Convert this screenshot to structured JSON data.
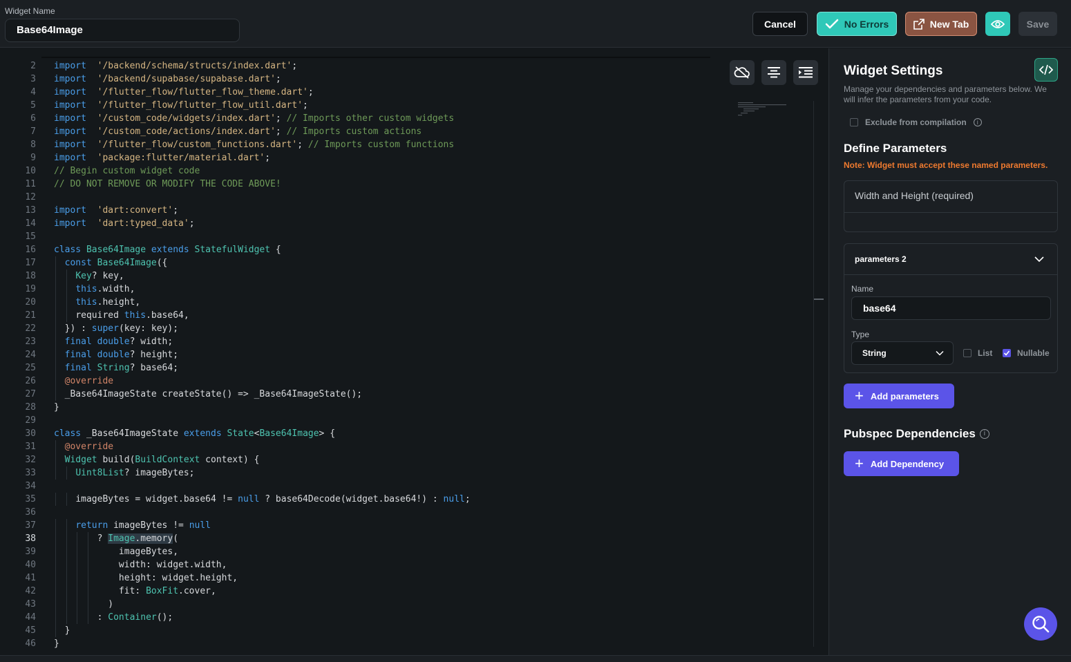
{
  "header": {
    "widget_name_label": "Widget Name",
    "widget_name_value": "Base64Image",
    "cancel_label": "Cancel",
    "no_errors_label": "No Errors",
    "new_tab_label": "New Tab",
    "save_label": "Save"
  },
  "editor": {
    "active_line": 38,
    "lines": [
      {
        "n": 2,
        "indent": 0,
        "tokens": [
          [
            "kw",
            "import"
          ],
          [
            "",
            "  "
          ],
          [
            "str",
            "'/backend/schema/structs/index.dart'"
          ],
          [
            "",
            ";"
          ]
        ]
      },
      {
        "n": 3,
        "indent": 0,
        "tokens": [
          [
            "kw",
            "import"
          ],
          [
            "",
            "  "
          ],
          [
            "str",
            "'/backend/supabase/supabase.dart'"
          ],
          [
            "",
            ";"
          ]
        ]
      },
      {
        "n": 4,
        "indent": 0,
        "tokens": [
          [
            "kw",
            "import"
          ],
          [
            "",
            "  "
          ],
          [
            "str",
            "'/flutter_flow/flutter_flow_theme.dart'"
          ],
          [
            "",
            ";"
          ]
        ]
      },
      {
        "n": 5,
        "indent": 0,
        "tokens": [
          [
            "kw",
            "import"
          ],
          [
            "",
            "  "
          ],
          [
            "str",
            "'/flutter_flow/flutter_flow_util.dart'"
          ],
          [
            "",
            ";"
          ]
        ]
      },
      {
        "n": 6,
        "indent": 0,
        "tokens": [
          [
            "kw",
            "import"
          ],
          [
            "",
            "  "
          ],
          [
            "str",
            "'/custom_code/widgets/index.dart'"
          ],
          [
            "",
            "; "
          ],
          [
            "cm",
            "// Imports other custom widgets"
          ]
        ]
      },
      {
        "n": 7,
        "indent": 0,
        "tokens": [
          [
            "kw",
            "import"
          ],
          [
            "",
            "  "
          ],
          [
            "str",
            "'/custom_code/actions/index.dart'"
          ],
          [
            "",
            "; "
          ],
          [
            "cm",
            "// Imports custom actions"
          ]
        ]
      },
      {
        "n": 8,
        "indent": 0,
        "tokens": [
          [
            "kw",
            "import"
          ],
          [
            "",
            "  "
          ],
          [
            "str",
            "'/flutter_flow/custom_functions.dart'"
          ],
          [
            "",
            "; "
          ],
          [
            "cm",
            "// Imports custom functions"
          ]
        ]
      },
      {
        "n": 9,
        "indent": 0,
        "tokens": [
          [
            "kw",
            "import"
          ],
          [
            "",
            "  "
          ],
          [
            "str",
            "'package:flutter/material.dart'"
          ],
          [
            "",
            ";"
          ]
        ]
      },
      {
        "n": 10,
        "indent": 0,
        "tokens": [
          [
            "cm",
            "// Begin custom widget code"
          ]
        ]
      },
      {
        "n": 11,
        "indent": 0,
        "tokens": [
          [
            "cm",
            "// DO NOT REMOVE OR MODIFY THE CODE ABOVE!"
          ]
        ]
      },
      {
        "n": 12,
        "indent": 0,
        "tokens": []
      },
      {
        "n": 13,
        "indent": 0,
        "tokens": [
          [
            "kw",
            "import"
          ],
          [
            "",
            "  "
          ],
          [
            "str",
            "'dart:convert'"
          ],
          [
            "",
            ";"
          ]
        ]
      },
      {
        "n": 14,
        "indent": 0,
        "tokens": [
          [
            "kw",
            "import"
          ],
          [
            "",
            "  "
          ],
          [
            "str",
            "'dart:typed_data'"
          ],
          [
            "",
            ";"
          ]
        ]
      },
      {
        "n": 15,
        "indent": 0,
        "tokens": []
      },
      {
        "n": 16,
        "indent": 0,
        "tokens": [
          [
            "kw",
            "class"
          ],
          [
            "",
            " "
          ],
          [
            "ty",
            "Base64Image"
          ],
          [
            "",
            " "
          ],
          [
            "kw",
            "extends"
          ],
          [
            "",
            " "
          ],
          [
            "ty",
            "StatefulWidget"
          ],
          [
            "",
            " {"
          ]
        ]
      },
      {
        "n": 17,
        "indent": 2,
        "tokens": [
          [
            "kw",
            "const"
          ],
          [
            "",
            " "
          ],
          [
            "ty",
            "Base64Image"
          ],
          [
            "",
            "({"
          ]
        ]
      },
      {
        "n": 18,
        "indent": 4,
        "tokens": [
          [
            "ty",
            "Key"
          ],
          [
            "",
            "? key,"
          ]
        ]
      },
      {
        "n": 19,
        "indent": 4,
        "tokens": [
          [
            "kw",
            "this"
          ],
          [
            "",
            ".width,"
          ]
        ]
      },
      {
        "n": 20,
        "indent": 4,
        "tokens": [
          [
            "kw",
            "this"
          ],
          [
            "",
            ".height,"
          ]
        ]
      },
      {
        "n": 21,
        "indent": 4,
        "tokens": [
          [
            "",
            "required "
          ],
          [
            "kw",
            "this"
          ],
          [
            "",
            ".base64,"
          ]
        ]
      },
      {
        "n": 22,
        "indent": 2,
        "tokens": [
          [
            "",
            "}) : "
          ],
          [
            "kw",
            "super"
          ],
          [
            "",
            "(key: key);"
          ]
        ]
      },
      {
        "n": 23,
        "indent": 2,
        "tokens": [
          [
            "kw",
            "final"
          ],
          [
            "",
            " "
          ],
          [
            "kw",
            "double"
          ],
          [
            "",
            "? width;"
          ]
        ]
      },
      {
        "n": 24,
        "indent": 2,
        "tokens": [
          [
            "kw",
            "final"
          ],
          [
            "",
            " "
          ],
          [
            "kw",
            "double"
          ],
          [
            "",
            "? height;"
          ]
        ]
      },
      {
        "n": 25,
        "indent": 2,
        "tokens": [
          [
            "kw",
            "final"
          ],
          [
            "",
            " "
          ],
          [
            "ty",
            "String"
          ],
          [
            "",
            "? base64;"
          ]
        ]
      },
      {
        "n": 26,
        "indent": 2,
        "tokens": [
          [
            "an",
            "@override"
          ]
        ]
      },
      {
        "n": 27,
        "indent": 2,
        "tokens": [
          [
            "",
            "_Base64ImageState createState() => _Base64ImageState();"
          ]
        ]
      },
      {
        "n": 28,
        "indent": 0,
        "tokens": [
          [
            "",
            "}"
          ]
        ]
      },
      {
        "n": 29,
        "indent": 0,
        "tokens": []
      },
      {
        "n": 30,
        "indent": 0,
        "tokens": [
          [
            "kw",
            "class"
          ],
          [
            "",
            " _Base64ImageState "
          ],
          [
            "kw",
            "extends"
          ],
          [
            "",
            " "
          ],
          [
            "ty",
            "State"
          ],
          [
            "",
            "<"
          ],
          [
            "ty",
            "Base64Image"
          ],
          [
            "",
            "> {"
          ]
        ]
      },
      {
        "n": 31,
        "indent": 2,
        "tokens": [
          [
            "an",
            "@override"
          ]
        ]
      },
      {
        "n": 32,
        "indent": 2,
        "tokens": [
          [
            "ty",
            "Widget"
          ],
          [
            "",
            " build("
          ],
          [
            "ty",
            "BuildContext"
          ],
          [
            "",
            " context) {"
          ]
        ]
      },
      {
        "n": 33,
        "indent": 4,
        "tokens": [
          [
            "ty",
            "Uint8List"
          ],
          [
            "",
            "? imageBytes;"
          ]
        ]
      },
      {
        "n": 34,
        "indent": 0,
        "tokens": []
      },
      {
        "n": 35,
        "indent": 4,
        "tokens": [
          [
            "",
            "imageBytes = widget.base64 != "
          ],
          [
            "kw",
            "null"
          ],
          [
            "",
            " ? base64Decode(widget.base64!) : "
          ],
          [
            "kw",
            "null"
          ],
          [
            "",
            ";"
          ]
        ]
      },
      {
        "n": 36,
        "indent": 0,
        "tokens": []
      },
      {
        "n": 37,
        "indent": 4,
        "tokens": [
          [
            "kw",
            "return"
          ],
          [
            "",
            " imageBytes != "
          ],
          [
            "kw",
            "null"
          ]
        ]
      },
      {
        "n": 38,
        "indent": 8,
        "tokens": [
          [
            "",
            "? "
          ],
          [
            "ty hl",
            "Image"
          ],
          [
            "hl",
            ".memory"
          ],
          [
            "",
            "("
          ]
        ]
      },
      {
        "n": 39,
        "indent": 12,
        "tokens": [
          [
            "",
            "imageBytes,"
          ]
        ]
      },
      {
        "n": 40,
        "indent": 12,
        "tokens": [
          [
            "",
            "width: widget.width,"
          ]
        ]
      },
      {
        "n": 41,
        "indent": 12,
        "tokens": [
          [
            "",
            "height: widget.height,"
          ]
        ]
      },
      {
        "n": 42,
        "indent": 12,
        "tokens": [
          [
            "",
            "fit: "
          ],
          [
            "ty",
            "BoxFit"
          ],
          [
            "",
            ".cover,"
          ]
        ]
      },
      {
        "n": 43,
        "indent": 10,
        "tokens": [
          [
            "",
            ")"
          ]
        ]
      },
      {
        "n": 44,
        "indent": 8,
        "tokens": [
          [
            "",
            ": "
          ],
          [
            "ty",
            "Container"
          ],
          [
            "",
            "();"
          ]
        ]
      },
      {
        "n": 45,
        "indent": 2,
        "tokens": [
          [
            "",
            "}"
          ]
        ]
      },
      {
        "n": 46,
        "indent": 0,
        "tokens": [
          [
            "",
            "}"
          ]
        ]
      }
    ]
  },
  "panel": {
    "title": "Widget Settings",
    "description": "Manage your dependencies and parameters below. We will infer the parameters from your code.",
    "exclude_label": "Exclude from compilation",
    "define_title": "Define Parameters",
    "define_note": "Note: Widget must accept these named parameters.",
    "width_height_label": "Width and Height (required)",
    "param_card": {
      "header": "parameters 2",
      "name_label": "Name",
      "name_value": "base64",
      "type_label": "Type",
      "type_value": "String",
      "list_label": "List",
      "list_checked": false,
      "nullable_label": "Nullable",
      "nullable_checked": true
    },
    "add_parameters_label": "Add parameters",
    "pubspec_title": "Pubspec Dependencies",
    "add_dependency_label": "Add Dependency"
  },
  "colors": {
    "accent": "#5b54e8",
    "success": "#2fc8b8",
    "warning": "#ef7a2f"
  },
  "icons": {
    "no_errors": "check-icon",
    "new_tab": "external-link-icon",
    "preview": "eye-icon",
    "cloud": "cloud-off-icon",
    "format": "align-center-icon",
    "indent": "indent-icon",
    "code": "code-icon",
    "fab": "search-icon"
  }
}
